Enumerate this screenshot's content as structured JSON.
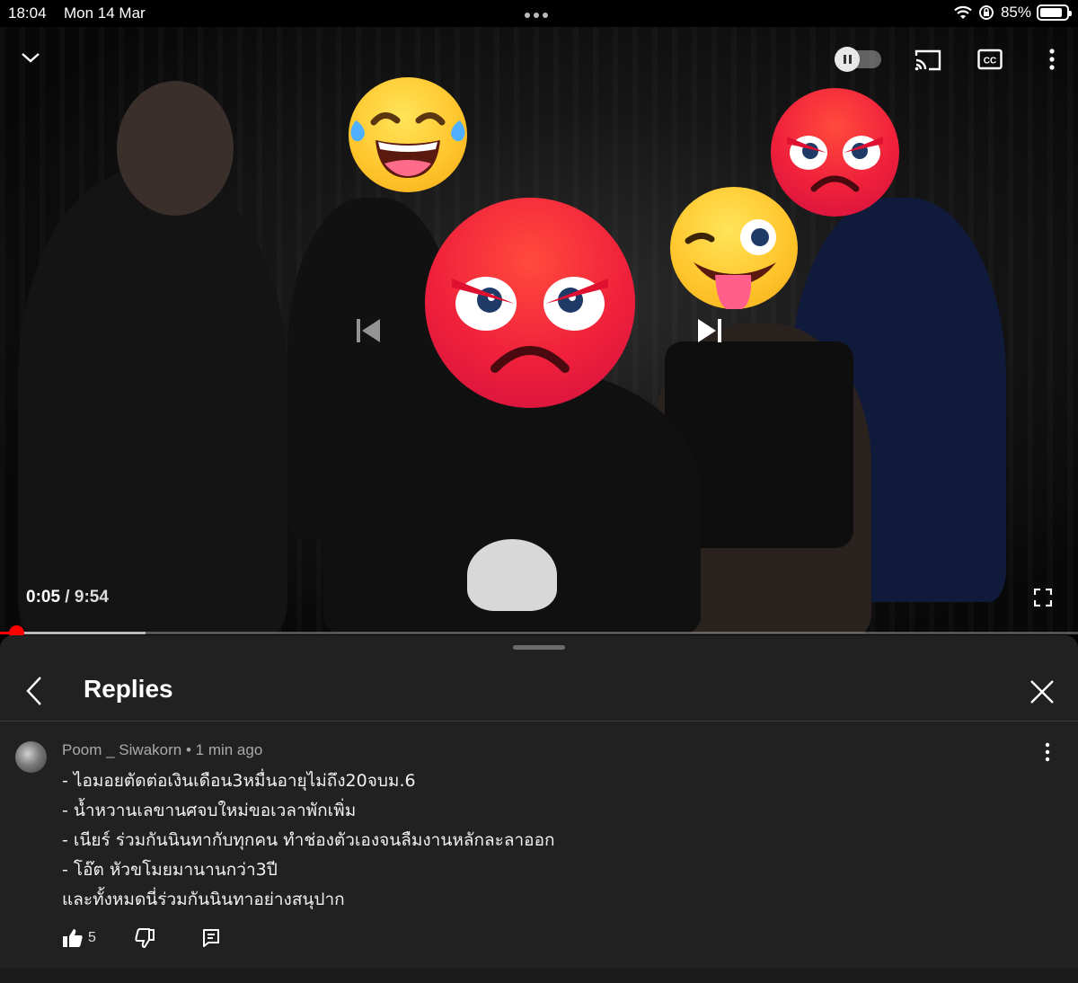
{
  "status_bar": {
    "time": "18:04",
    "date": "Mon 14 Mar",
    "battery_percent": "85%",
    "battery_level": 0.85
  },
  "player": {
    "current_time": "0:05",
    "separator": " / ",
    "duration": "9:54",
    "progress_fraction": 0.0084,
    "buffered_fraction": 0.27,
    "progress_color": "#ff0000",
    "autoplay_on": false,
    "icons": [
      "chevron-down-icon",
      "pause-icon",
      "cast-icon",
      "cc-icon",
      "more-vert-icon",
      "previous-icon",
      "next-icon",
      "fullscreen-icon"
    ],
    "overlay_emojis": [
      "angry-face",
      "angry-face",
      "tears-of-joy-face",
      "winking-tongue-face"
    ]
  },
  "replies_panel": {
    "title": "Replies",
    "background": "#212121",
    "comment": {
      "author": "Poom _ Siwakorn",
      "separator": " • ",
      "timestamp": "1 min ago",
      "lines": [
        "- ไอมอยตัดต่อเงินเดือน3หมื่นอายุไม่ถึง20จบม.6",
        "- น้ำหวานเลขานศจบใหม่ขอเวลาพักเพิ่ม",
        "- เนียร์ ร่วมกันนินทากับทุกคน ทำช่องตัวเองจนลืมงานหลักละลาออก",
        "- โอ๊ต หัวขโมยมานานกว่า3ปี",
        "และทั้งหมดนี่ร่วมกันนินทาอย่างสนุปาก"
      ],
      "like_count": "5"
    }
  }
}
